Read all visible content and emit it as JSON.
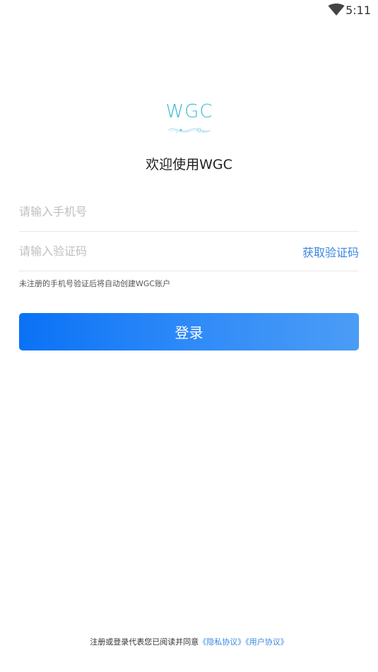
{
  "status_bar": {
    "time": "5:11",
    "icons": [
      "wifi-icon"
    ]
  },
  "logo": {
    "text": "WGC",
    "accent": "#3cbad4"
  },
  "welcome": "欢迎使用WGC",
  "form": {
    "phone_placeholder": "请输入手机号",
    "code_placeholder": "请输入验证码",
    "get_code_label": "获取验证码",
    "hint": "未注册的手机号验证后将自动创建WGC账户",
    "login_label": "登录"
  },
  "agreement": {
    "prefix": "注册或登录代表您已阅读并同意",
    "privacy_link": "《隐私协议》",
    "user_link": "《用户协议》"
  },
  "colors": {
    "primary_button_start": "#0a72f5",
    "primary_button_end": "#4b9cf5",
    "link": "#3a86e0"
  }
}
